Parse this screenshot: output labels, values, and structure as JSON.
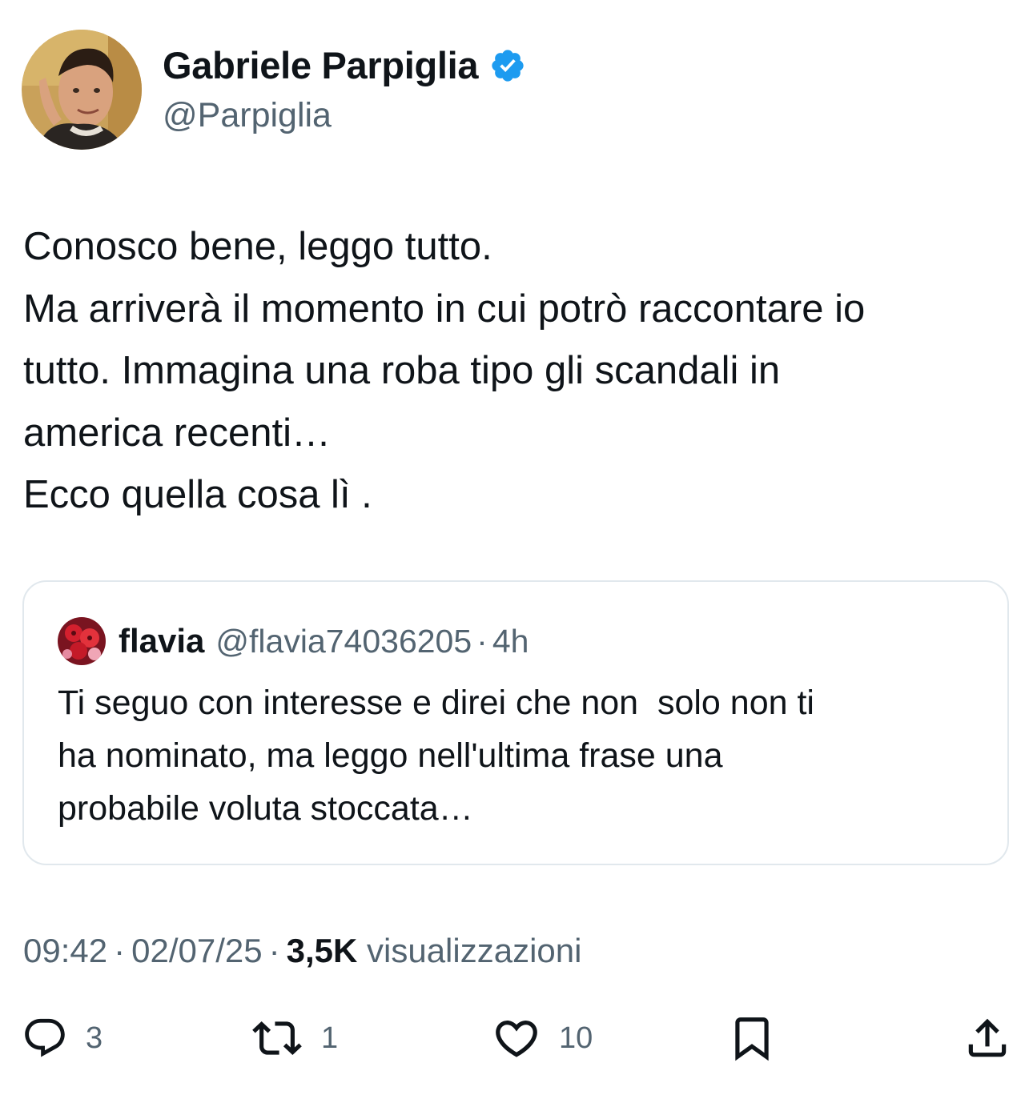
{
  "author": {
    "display_name": "Gabriele Parpiglia",
    "handle": "@Parpiglia",
    "verified_icon": "verified-badge-icon",
    "verified_color": "#1d9bf0"
  },
  "tweet": {
    "lines": [
      "Conosco bene, leggo tutto.",
      "Ma arriverà il momento in cui potrò raccontare io",
      "tutto. Immagina una roba tipo gli scandali in",
      "america recenti…",
      "Ecco quella cosa lì ."
    ]
  },
  "quote": {
    "name": "flavia",
    "handle": "@flavia74036205",
    "separator": "·",
    "time": "4h",
    "lines": [
      "Ti seguo con interesse e direi che non  solo non ti",
      "ha nominato, ma leggo nell'ultima frase una",
      "probabile voluta stoccata…"
    ]
  },
  "meta": {
    "time": "09:42",
    "separator": "·",
    "date": "02/07/25",
    "views_count": "3,5K",
    "views_label": "visualizzazioni"
  },
  "actions": {
    "reply": {
      "icon": "reply-icon",
      "count": "3"
    },
    "retweet": {
      "icon": "retweet-icon",
      "count": "1"
    },
    "like": {
      "icon": "like-icon",
      "count": "10"
    },
    "bookmark": {
      "icon": "bookmark-icon"
    },
    "share": {
      "icon": "share-icon"
    }
  },
  "colors": {
    "text_primary": "#0f1419",
    "text_secondary": "#536471",
    "border": "#e1e8ed",
    "accent": "#1d9bf0"
  }
}
